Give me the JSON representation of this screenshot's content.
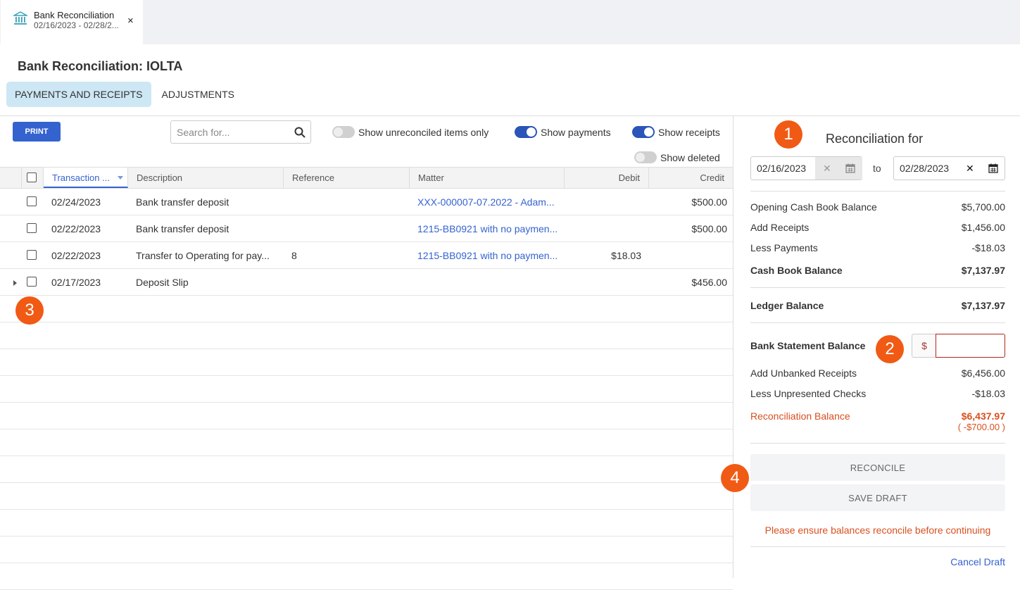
{
  "tab": {
    "title": "Bank Reconciliation",
    "subtitle": "02/16/2023 - 02/28/2...",
    "close": "×"
  },
  "page_title": "Bank Reconciliation: IOLTA",
  "subtabs": [
    "PAYMENTS AND RECEIPTS",
    "ADJUSTMENTS"
  ],
  "toolbar": {
    "print_label": "PRINT",
    "search_placeholder": "Search for...",
    "toggles": {
      "unreconciled": {
        "label": "Show unreconciled items only",
        "on": false
      },
      "payments": {
        "label": "Show payments",
        "on": true
      },
      "receipts": {
        "label": "Show receipts",
        "on": true
      },
      "deleted": {
        "label": "Show deleted",
        "on": false
      }
    }
  },
  "table": {
    "columns": [
      "Transaction ...",
      "Description",
      "Reference",
      "Matter",
      "Debit",
      "Credit"
    ],
    "rows": [
      {
        "date": "02/24/2023",
        "description": "Bank transfer deposit",
        "reference": "",
        "matter": "XXX-000007-07.2022 - Adam...",
        "debit": "",
        "credit": "$500.00",
        "expandable": false
      },
      {
        "date": "02/22/2023",
        "description": "Bank transfer deposit",
        "reference": "",
        "matter": "1215-BB0921 with no paymen...",
        "debit": "",
        "credit": "$500.00",
        "expandable": false
      },
      {
        "date": "02/22/2023",
        "description": "Transfer to Operating for pay...",
        "reference": "8",
        "matter": "1215-BB0921 with no paymen...",
        "debit": "$18.03",
        "credit": "",
        "expandable": false
      },
      {
        "date": "02/17/2023",
        "description": "Deposit Slip",
        "reference": "",
        "matter": "",
        "debit": "",
        "credit": "$456.00",
        "expandable": true
      }
    ]
  },
  "panel": {
    "title": "Reconciliation for",
    "from_date": "02/16/2023",
    "to_label": "to",
    "to_date": "02/28/2023",
    "opening": {
      "label": "Opening Cash Book Balance",
      "value": "$5,700.00"
    },
    "add_receipts": {
      "label": "Add Receipts",
      "value": "$1,456.00"
    },
    "less_payments": {
      "label": "Less Payments",
      "value": "-$18.03"
    },
    "cash_book": {
      "label": "Cash Book Balance",
      "value": "$7,137.97"
    },
    "ledger": {
      "label": "Ledger Balance",
      "value": "$7,137.97"
    },
    "bank_statement": {
      "label": "Bank Statement Balance",
      "currency": "$",
      "value": ""
    },
    "unbanked": {
      "label": "Add Unbanked Receipts",
      "value": "$6,456.00"
    },
    "unpresented": {
      "label": "Less Unpresented Checks",
      "value": "-$18.03"
    },
    "reconciliation": {
      "label": "Reconciliation Balance",
      "value": "$6,437.97",
      "difference": "( -$700.00 )"
    },
    "reconcile_label": "RECONCILE",
    "save_draft_label": "SAVE DRAFT",
    "warning": "Please ensure balances reconcile before continuing",
    "cancel_draft": "Cancel Draft"
  },
  "badges": [
    "1",
    "2",
    "3",
    "4"
  ],
  "colors": {
    "accent": "#3463cf",
    "badge": "#f05a14",
    "warning": "#d94f1e",
    "active_tab": "#cde7f4"
  }
}
